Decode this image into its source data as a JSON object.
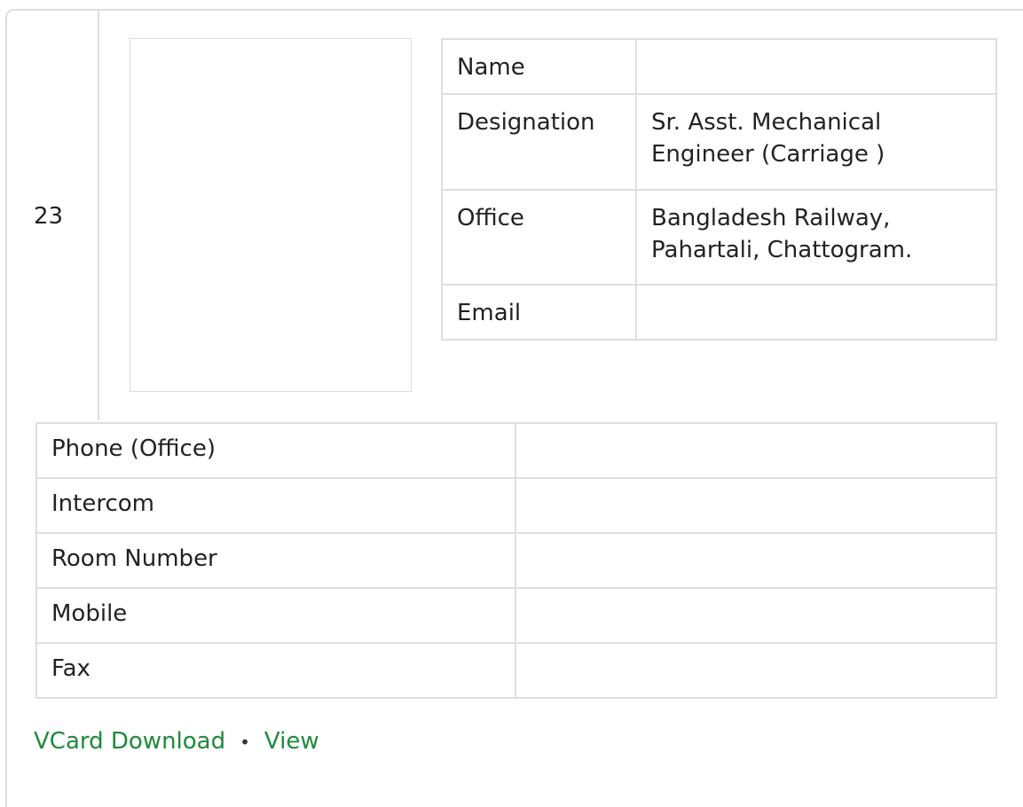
{
  "serial": "23",
  "info": {
    "rows": [
      {
        "label": "Name",
        "value": ""
      },
      {
        "label": "Designation",
        "value": "Sr. Asst. Mechanical Engineer (Carriage )"
      },
      {
        "label": "Office",
        "value": "Bangladesh Railway, Pahartali, Chattogram."
      },
      {
        "label": "Email",
        "value": ""
      }
    ]
  },
  "contact": {
    "rows": [
      {
        "label": "Phone (Office)",
        "value": ""
      },
      {
        "label": "Intercom",
        "value": ""
      },
      {
        "label": "Room Number",
        "value": ""
      },
      {
        "label": "Mobile",
        "value": ""
      },
      {
        "label": "Fax",
        "value": ""
      }
    ]
  },
  "links": {
    "vcard_label": "VCard Download",
    "separator": "•",
    "view_label": "View"
  },
  "colors": {
    "link": "#1d8a3a",
    "border": "#dedede"
  }
}
